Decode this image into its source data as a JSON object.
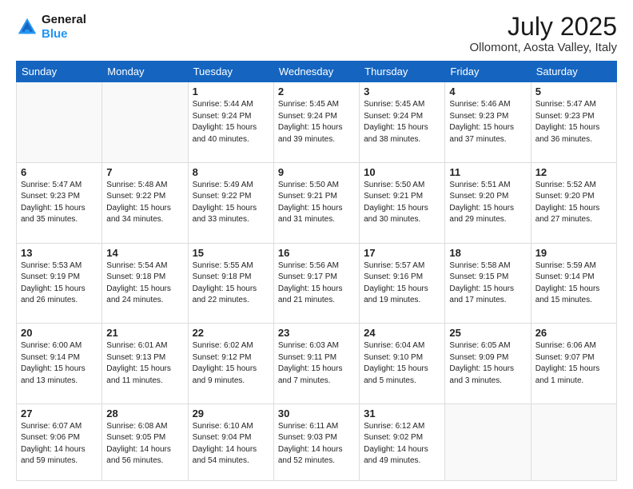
{
  "logo": {
    "line1": "General",
    "line2": "Blue"
  },
  "title": "July 2025",
  "subtitle": "Ollomont, Aosta Valley, Italy",
  "weekdays": [
    "Sunday",
    "Monday",
    "Tuesday",
    "Wednesday",
    "Thursday",
    "Friday",
    "Saturday"
  ],
  "weeks": [
    [
      {
        "day": "",
        "info": ""
      },
      {
        "day": "",
        "info": ""
      },
      {
        "day": "1",
        "info": "Sunrise: 5:44 AM\nSunset: 9:24 PM\nDaylight: 15 hours\nand 40 minutes."
      },
      {
        "day": "2",
        "info": "Sunrise: 5:45 AM\nSunset: 9:24 PM\nDaylight: 15 hours\nand 39 minutes."
      },
      {
        "day": "3",
        "info": "Sunrise: 5:45 AM\nSunset: 9:24 PM\nDaylight: 15 hours\nand 38 minutes."
      },
      {
        "day": "4",
        "info": "Sunrise: 5:46 AM\nSunset: 9:23 PM\nDaylight: 15 hours\nand 37 minutes."
      },
      {
        "day": "5",
        "info": "Sunrise: 5:47 AM\nSunset: 9:23 PM\nDaylight: 15 hours\nand 36 minutes."
      }
    ],
    [
      {
        "day": "6",
        "info": "Sunrise: 5:47 AM\nSunset: 9:23 PM\nDaylight: 15 hours\nand 35 minutes."
      },
      {
        "day": "7",
        "info": "Sunrise: 5:48 AM\nSunset: 9:22 PM\nDaylight: 15 hours\nand 34 minutes."
      },
      {
        "day": "8",
        "info": "Sunrise: 5:49 AM\nSunset: 9:22 PM\nDaylight: 15 hours\nand 33 minutes."
      },
      {
        "day": "9",
        "info": "Sunrise: 5:50 AM\nSunset: 9:21 PM\nDaylight: 15 hours\nand 31 minutes."
      },
      {
        "day": "10",
        "info": "Sunrise: 5:50 AM\nSunset: 9:21 PM\nDaylight: 15 hours\nand 30 minutes."
      },
      {
        "day": "11",
        "info": "Sunrise: 5:51 AM\nSunset: 9:20 PM\nDaylight: 15 hours\nand 29 minutes."
      },
      {
        "day": "12",
        "info": "Sunrise: 5:52 AM\nSunset: 9:20 PM\nDaylight: 15 hours\nand 27 minutes."
      }
    ],
    [
      {
        "day": "13",
        "info": "Sunrise: 5:53 AM\nSunset: 9:19 PM\nDaylight: 15 hours\nand 26 minutes."
      },
      {
        "day": "14",
        "info": "Sunrise: 5:54 AM\nSunset: 9:18 PM\nDaylight: 15 hours\nand 24 minutes."
      },
      {
        "day": "15",
        "info": "Sunrise: 5:55 AM\nSunset: 9:18 PM\nDaylight: 15 hours\nand 22 minutes."
      },
      {
        "day": "16",
        "info": "Sunrise: 5:56 AM\nSunset: 9:17 PM\nDaylight: 15 hours\nand 21 minutes."
      },
      {
        "day": "17",
        "info": "Sunrise: 5:57 AM\nSunset: 9:16 PM\nDaylight: 15 hours\nand 19 minutes."
      },
      {
        "day": "18",
        "info": "Sunrise: 5:58 AM\nSunset: 9:15 PM\nDaylight: 15 hours\nand 17 minutes."
      },
      {
        "day": "19",
        "info": "Sunrise: 5:59 AM\nSunset: 9:14 PM\nDaylight: 15 hours\nand 15 minutes."
      }
    ],
    [
      {
        "day": "20",
        "info": "Sunrise: 6:00 AM\nSunset: 9:14 PM\nDaylight: 15 hours\nand 13 minutes."
      },
      {
        "day": "21",
        "info": "Sunrise: 6:01 AM\nSunset: 9:13 PM\nDaylight: 15 hours\nand 11 minutes."
      },
      {
        "day": "22",
        "info": "Sunrise: 6:02 AM\nSunset: 9:12 PM\nDaylight: 15 hours\nand 9 minutes."
      },
      {
        "day": "23",
        "info": "Sunrise: 6:03 AM\nSunset: 9:11 PM\nDaylight: 15 hours\nand 7 minutes."
      },
      {
        "day": "24",
        "info": "Sunrise: 6:04 AM\nSunset: 9:10 PM\nDaylight: 15 hours\nand 5 minutes."
      },
      {
        "day": "25",
        "info": "Sunrise: 6:05 AM\nSunset: 9:09 PM\nDaylight: 15 hours\nand 3 minutes."
      },
      {
        "day": "26",
        "info": "Sunrise: 6:06 AM\nSunset: 9:07 PM\nDaylight: 15 hours\nand 1 minute."
      }
    ],
    [
      {
        "day": "27",
        "info": "Sunrise: 6:07 AM\nSunset: 9:06 PM\nDaylight: 14 hours\nand 59 minutes."
      },
      {
        "day": "28",
        "info": "Sunrise: 6:08 AM\nSunset: 9:05 PM\nDaylight: 14 hours\nand 56 minutes."
      },
      {
        "day": "29",
        "info": "Sunrise: 6:10 AM\nSunset: 9:04 PM\nDaylight: 14 hours\nand 54 minutes."
      },
      {
        "day": "30",
        "info": "Sunrise: 6:11 AM\nSunset: 9:03 PM\nDaylight: 14 hours\nand 52 minutes."
      },
      {
        "day": "31",
        "info": "Sunrise: 6:12 AM\nSunset: 9:02 PM\nDaylight: 14 hours\nand 49 minutes."
      },
      {
        "day": "",
        "info": ""
      },
      {
        "day": "",
        "info": ""
      }
    ]
  ]
}
